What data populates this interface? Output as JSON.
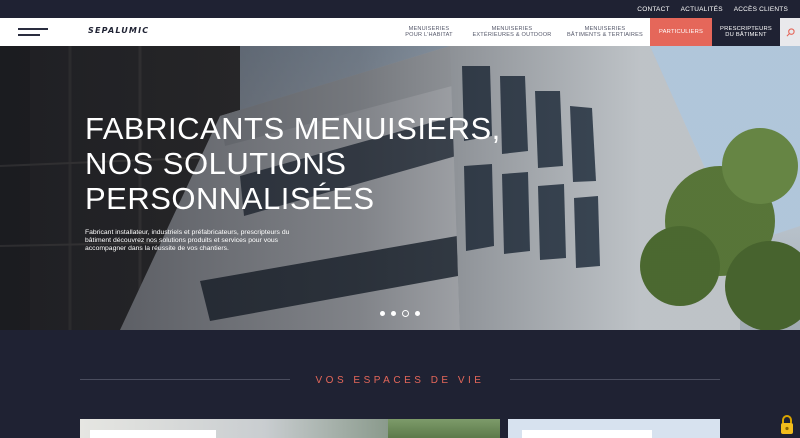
{
  "topbar": {
    "links": [
      "CONTACT",
      "ACTUALITÉS",
      "ACCÈS CLIENTS"
    ]
  },
  "nav": {
    "logo": "SEPALUMIC",
    "menu": [
      {
        "line1": "MENUISERIES",
        "line2": "POUR L'HABITAT"
      },
      {
        "line1": "MENUISERIES",
        "line2": "EXTÉRIEURES & OUTDOOR"
      },
      {
        "line1": "MENUISERIES",
        "line2": "BÂTIMENTS & TERTIAIRES"
      }
    ],
    "particuliers": "PARTICULIERS",
    "prescripteurs": {
      "line1": "PRESCRIPTEURS",
      "line2": "DU BÂTIMENT"
    }
  },
  "hero": {
    "title_lines": [
      "FABRICANTS MENUISIERS,",
      "NOS SOLUTIONS",
      "PERSONNALISÉES"
    ],
    "text": "Fabricant installateur, industriels et préfabricateurs, prescripteurs du bâtiment découvrez nos solutions produits et services pour vous accompagner dans la réussite de vos chantiers.",
    "slides_count": 4,
    "active_slide": 3
  },
  "section": {
    "title": "VOS ESPACES DE VIE"
  },
  "colors": {
    "navy": "#1f2233",
    "accent": "#e5675a",
    "white": "#ffffff"
  }
}
